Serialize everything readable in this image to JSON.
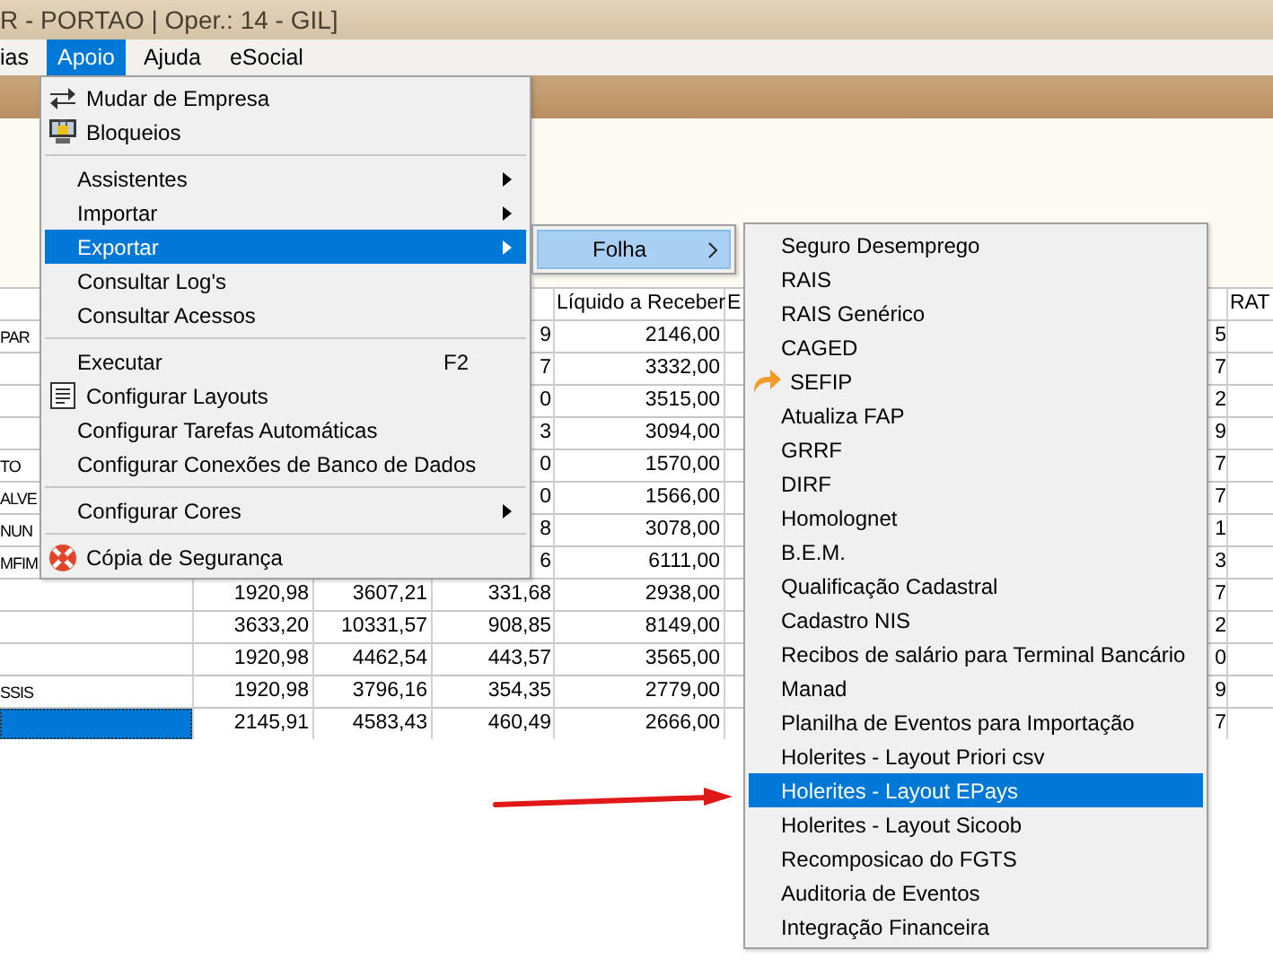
{
  "window": {
    "title": "R - PORTAO | Oper.: 14 - GIL]"
  },
  "menu_bar": [
    {
      "label": "ias",
      "selected": false
    },
    {
      "label": "Apoio",
      "selected": true
    },
    {
      "label": "Ajuda",
      "selected": false
    },
    {
      "label": "eSocial",
      "selected": false
    }
  ],
  "apoio_menu": [
    {
      "kind": "swap",
      "label": "Mudar de Empresa",
      "submenu": false,
      "selected": false
    },
    {
      "kind": "lock",
      "label": "Bloqueios",
      "submenu": false,
      "selected": false
    },
    {
      "kind": "separator"
    },
    {
      "kind": "plain",
      "label": "Assistentes",
      "submenu": true,
      "selected": false
    },
    {
      "kind": "plain",
      "label": "Importar",
      "submenu": true,
      "selected": false
    },
    {
      "kind": "plain",
      "label": "Exportar",
      "submenu": true,
      "selected": true
    },
    {
      "kind": "plain",
      "label": "Consultar Log's",
      "submenu": false,
      "selected": false
    },
    {
      "kind": "plain",
      "label": "Consultar Acessos",
      "submenu": false,
      "selected": false
    },
    {
      "kind": "separator"
    },
    {
      "kind": "plain",
      "label": "Executar",
      "shortcut": "F2",
      "submenu": false,
      "selected": false
    },
    {
      "kind": "layout",
      "label": "Configurar Layouts",
      "submenu": false,
      "selected": false
    },
    {
      "kind": "plain",
      "label": "Configurar Tarefas Automáticas",
      "submenu": false,
      "selected": false
    },
    {
      "kind": "plain",
      "label": "Configurar Conexões de Banco de Dados",
      "submenu": false,
      "selected": false
    },
    {
      "kind": "separator"
    },
    {
      "kind": "plain",
      "label": "Configurar Cores",
      "submenu": true,
      "selected": false
    },
    {
      "kind": "separator"
    },
    {
      "kind": "backup",
      "label": "Cópia de Segurança",
      "submenu": false,
      "selected": false
    }
  ],
  "exportar_menu": [
    {
      "label": "Folha",
      "selected": true
    }
  ],
  "folha_menu": [
    {
      "kind": "plain",
      "label": "Seguro Desemprego",
      "selected": false
    },
    {
      "kind": "plain",
      "label": "RAIS",
      "selected": false
    },
    {
      "kind": "plain",
      "label": "RAIS Genérico",
      "selected": false
    },
    {
      "kind": "plain",
      "label": "CAGED",
      "selected": false
    },
    {
      "kind": "redo",
      "label": "SEFIP",
      "selected": false
    },
    {
      "kind": "plain",
      "label": "Atualiza FAP",
      "selected": false
    },
    {
      "kind": "plain",
      "label": "GRRF",
      "selected": false
    },
    {
      "kind": "plain",
      "label": "DIRF",
      "selected": false
    },
    {
      "kind": "plain",
      "label": "Homolognet",
      "selected": false
    },
    {
      "kind": "plain",
      "label": "B.E.M.",
      "selected": false
    },
    {
      "kind": "plain",
      "label": "Qualificação Cadastral",
      "selected": false
    },
    {
      "kind": "plain",
      "label": "Cadastro NIS",
      "selected": false
    },
    {
      "kind": "plain",
      "label": "Recibos de salário para Terminal Bancário",
      "selected": false
    },
    {
      "kind": "plain",
      "label": "Manad",
      "selected": false
    },
    {
      "kind": "plain",
      "label": "Planilha de Eventos para Importação",
      "selected": false
    },
    {
      "kind": "plain",
      "label": "Holerites - Layout Priori csv",
      "selected": false
    },
    {
      "kind": "plain",
      "label": "Holerites - Layout EPays",
      "selected": true
    },
    {
      "kind": "plain",
      "label": "Holerites - Layout Sicoob",
      "selected": false
    },
    {
      "kind": "plain",
      "label": "Recomposicao do FGTS",
      "selected": false
    },
    {
      "kind": "plain",
      "label": "Auditoria de Eventos",
      "selected": false
    },
    {
      "kind": "plain",
      "label": "Integração Financeira",
      "selected": false
    }
  ],
  "table": {
    "columns": [
      {
        "label": "Líquido a Receber"
      },
      {
        "label": "E"
      },
      {
        "label": "RAT"
      }
    ],
    "rows": [
      {
        "column_1": "PAR",
        "column_4": "9",
        "liquido": "2146,00",
        "column_7": "5",
        "selected": false
      },
      {
        "column_4": "7",
        "liquido": "3332,00",
        "column_7": "7",
        "selected": false
      },
      {
        "column_4": "0",
        "liquido": "3515,00",
        "column_7": "2",
        "selected": false
      },
      {
        "column_4": "3",
        "liquido": "3094,00",
        "column_7": "9",
        "selected": false
      },
      {
        "column_1": "TO",
        "column_4": "0",
        "liquido": "1570,00",
        "column_7": "7",
        "selected": false
      },
      {
        "column_1": "ALVE",
        "column_4": "0",
        "liquido": "1566,00",
        "column_7": "7",
        "selected": false
      },
      {
        "column_1": "NUN",
        "column_4": "8",
        "liquido": "3078,00",
        "column_7": "1",
        "selected": false
      },
      {
        "column_1": "MFIM",
        "column_4": "6",
        "liquido": "6111,00",
        "column_7": "3",
        "selected": false
      },
      {
        "column_2": "1920,98",
        "column_3": "3607,21",
        "column_4": "331,68",
        "liquido": "2938,00",
        "column_7": "7",
        "selected": false
      },
      {
        "column_2": "3633,20",
        "column_3": "10331,57",
        "column_4": "908,85",
        "liquido": "8149,00",
        "column_7": "2",
        "selected": false
      },
      {
        "column_2": "1920,98",
        "column_3": "4462,54",
        "column_4": "443,57",
        "liquido": "3565,00",
        "column_7": "0",
        "selected": false
      },
      {
        "column_1": "SSIS",
        "column_2": "1920,98",
        "column_3": "3796,16",
        "column_4": "354,35",
        "liquido": "2779,00",
        "column_7": "9",
        "selected": false
      },
      {
        "column_2": "2145,91",
        "column_3": "4583,43",
        "column_4": "460,49",
        "liquido": "2666,00",
        "column_7": "7",
        "selected": true
      }
    ]
  }
}
